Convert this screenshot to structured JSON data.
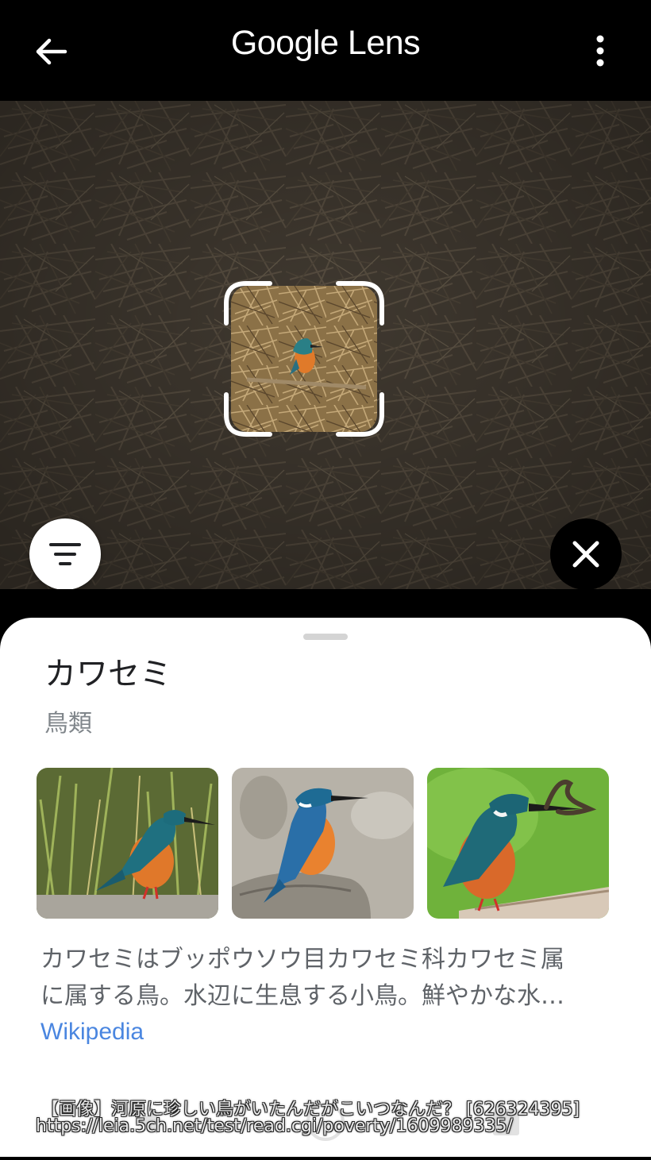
{
  "header": {
    "title": "Google Lens",
    "back_icon": "arrow-left-icon",
    "menu_icon": "more-vert-icon"
  },
  "scene": {
    "filter_icon": "filter-list-icon",
    "close_icon": "close-icon"
  },
  "result": {
    "title": "カワセミ",
    "subtitle": "鳥類",
    "description_lines": [
      "カワセミはブッポウソウ目カワセミ科カワセミ属",
      "に属する鳥。水辺に生息する小鳥。鮮やかな水…"
    ],
    "source": "Wikipedia"
  },
  "overlay": {
    "line1": "【画像】河原に珍しい鳥がいたんだがこいつなんだ？ [626324395]",
    "line2": "https://leia.5ch.net/test/read.cgi/poverty/1609989335/"
  },
  "colors": {
    "link": "#4a86e0",
    "title": "#202124",
    "muted": "#80868b"
  }
}
